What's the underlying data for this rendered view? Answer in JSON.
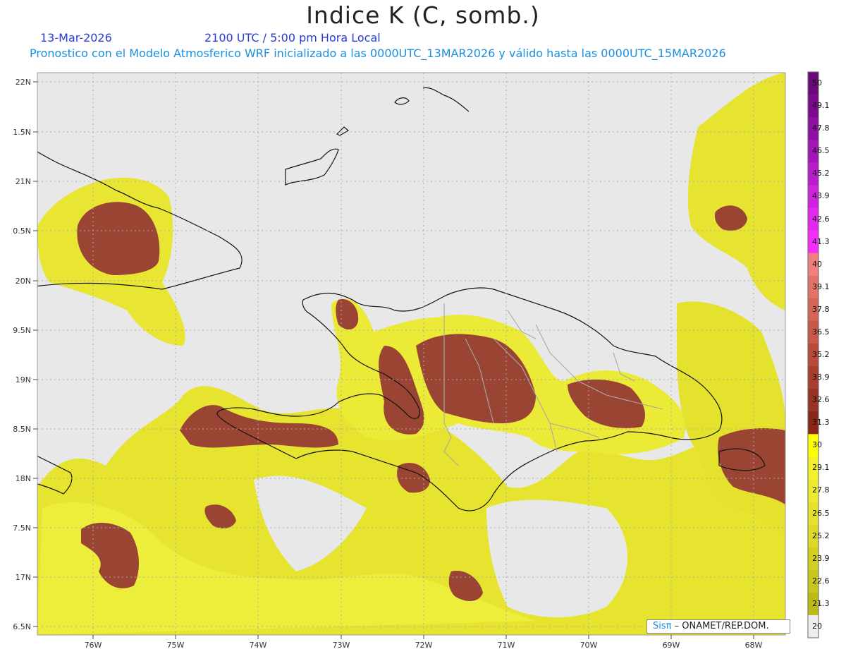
{
  "header": {
    "title": "Indice K (C, somb.)",
    "date": "13-Mar-2026",
    "time": "2100 UTC / 5:00 pm Hora Local",
    "description": "Pronostico con el Modelo Atmosferico WRF inicializado a las 0000UTC_13MAR2026 y válido hasta las  0000UTC_15MAR2026"
  },
  "axes": {
    "lat_labels": [
      "22N",
      "1.5N",
      "21N",
      "0.5N",
      "20N",
      "9.5N",
      "19N",
      "8.5N",
      "18N",
      "7.5N",
      "17N",
      "6.5N"
    ],
    "lon_labels": [
      "76W",
      "75W",
      "74W",
      "73W",
      "72W",
      "71W",
      "70W",
      "69W",
      "68W"
    ]
  },
  "colorbar": {
    "labels": [
      "50",
      "49.1",
      "47.8",
      "46.5",
      "45.2",
      "43.9",
      "42.6",
      "41.3",
      "40",
      "39.1",
      "37.8",
      "36.5",
      "35.2",
      "33.9",
      "32.6",
      "31.3",
      "30",
      "29.1",
      "27.8",
      "26.5",
      "25.2",
      "23.9",
      "22.6",
      "21.3",
      "20"
    ],
    "colors": [
      "#6a0a78",
      "#7a0c8c",
      "#8e10a3",
      "#a316b8",
      "#b91ccc",
      "#cf22df",
      "#e228ee",
      "#f52efc",
      "#f08080",
      "#e07268",
      "#d46658",
      "#c8584a",
      "#b84a3c",
      "#a83e30",
      "#983224",
      "#882818",
      "#ffff00",
      "#f4f22a",
      "#eceb30",
      "#e4e22c",
      "#dcd928",
      "#d2cf22",
      "#c8c51c",
      "#bdba16",
      "#eeeeee"
    ],
    "fill_colors": {
      "ocean": "#e8e8e8",
      "low": "#efee3a",
      "mid": "#e2e030",
      "high": "#9a4434"
    }
  },
  "credit": {
    "sis": "Sisπ",
    "text": "– ONAMET/REP.DOM."
  }
}
